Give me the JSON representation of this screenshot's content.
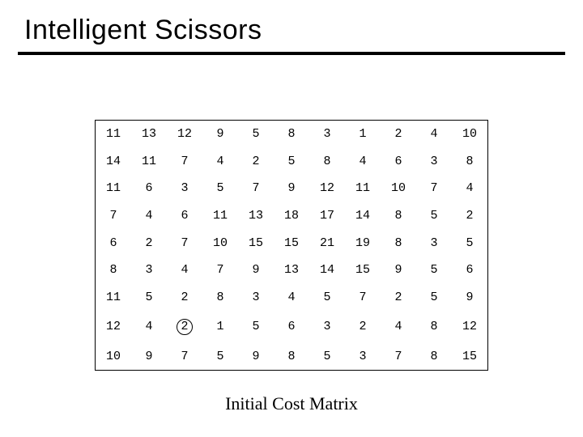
{
  "title": "Intelligent Scissors",
  "caption": "Initial Cost Matrix",
  "matrix": {
    "rows": [
      [
        11,
        13,
        12,
        9,
        5,
        8,
        3,
        1,
        2,
        4,
        10
      ],
      [
        14,
        11,
        7,
        4,
        2,
        5,
        8,
        4,
        6,
        3,
        8
      ],
      [
        11,
        6,
        3,
        5,
        7,
        9,
        12,
        11,
        10,
        7,
        4
      ],
      [
        7,
        4,
        6,
        11,
        13,
        18,
        17,
        14,
        8,
        5,
        2
      ],
      [
        6,
        2,
        7,
        10,
        15,
        15,
        21,
        19,
        8,
        3,
        5
      ],
      [
        8,
        3,
        4,
        7,
        9,
        13,
        14,
        15,
        9,
        5,
        6
      ],
      [
        11,
        5,
        2,
        8,
        3,
        4,
        5,
        7,
        2,
        5,
        9
      ],
      [
        12,
        4,
        2,
        1,
        5,
        6,
        3,
        2,
        4,
        8,
        12
      ],
      [
        10,
        9,
        7,
        5,
        9,
        8,
        5,
        3,
        7,
        8,
        15
      ]
    ],
    "circled": {
      "row": 7,
      "col": 2
    }
  },
  "chart_data": {
    "type": "table",
    "title": "Initial Cost Matrix",
    "n_rows": 9,
    "n_cols": 11,
    "values": [
      [
        11,
        13,
        12,
        9,
        5,
        8,
        3,
        1,
        2,
        4,
        10
      ],
      [
        14,
        11,
        7,
        4,
        2,
        5,
        8,
        4,
        6,
        3,
        8
      ],
      [
        11,
        6,
        3,
        5,
        7,
        9,
        12,
        11,
        10,
        7,
        4
      ],
      [
        7,
        4,
        6,
        11,
        13,
        18,
        17,
        14,
        8,
        5,
        2
      ],
      [
        6,
        2,
        7,
        10,
        15,
        15,
        21,
        19,
        8,
        3,
        5
      ],
      [
        8,
        3,
        4,
        7,
        9,
        13,
        14,
        15,
        9,
        5,
        6
      ],
      [
        11,
        5,
        2,
        8,
        3,
        4,
        5,
        7,
        2,
        5,
        9
      ],
      [
        12,
        4,
        2,
        1,
        5,
        6,
        3,
        2,
        4,
        8,
        12
      ],
      [
        10,
        9,
        7,
        5,
        9,
        8,
        5,
        3,
        7,
        8,
        15
      ]
    ],
    "highlighted_cell": {
      "row_index": 7,
      "col_index": 2,
      "value": 2,
      "style": "circle"
    }
  }
}
